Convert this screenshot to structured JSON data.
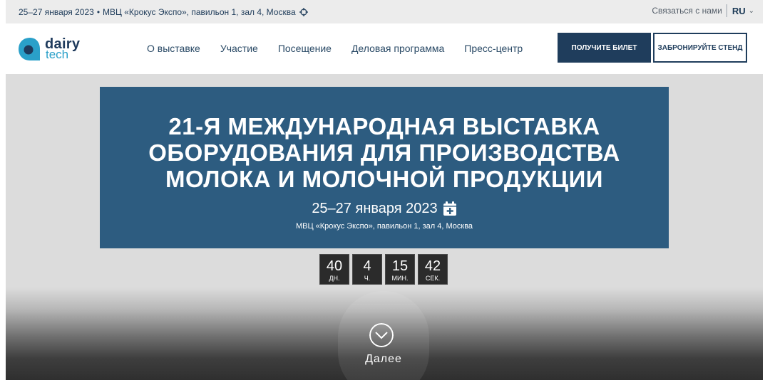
{
  "topbar": {
    "dates": "25–27 января 2023",
    "separator": "•",
    "venue": "МВЦ «Крокус Экспо», павильон 1, зал 4, Москва",
    "contact_label": "Связаться с нами",
    "language": "RU"
  },
  "header": {
    "logo_line1": "dairy",
    "logo_line2": "tech",
    "nav": [
      {
        "label": "О выставке"
      },
      {
        "label": "Участие"
      },
      {
        "label": "Посещение"
      },
      {
        "label": "Деловая программа"
      },
      {
        "label": "Пресс-центр"
      }
    ],
    "ticket_button": "ПОЛУЧИТЕ БИЛЕТ",
    "stand_button": "ЗАБРОНИРУЙТЕ СТЕНД"
  },
  "hero": {
    "title_line1": "21-Я МЕЖДУНАРОДНАЯ ВЫСТАВКА",
    "title_line2": "ОБОРУДОВАНИЯ ДЛЯ ПРОИЗВОДСТВА",
    "title_line3": "МОЛОКА И МОЛОЧНОЙ ПРОДУКЦИИ",
    "date": "25–27 января 2023",
    "venue": "МВЦ «Крокус Экспо», павильон 1, зал 4, Москва",
    "countdown": [
      {
        "value": "40",
        "unit": "ДН."
      },
      {
        "value": "4",
        "unit": "Ч."
      },
      {
        "value": "15",
        "unit": "МИН."
      },
      {
        "value": "42",
        "unit": "СЕК."
      }
    ],
    "scroll_label": "Далее"
  },
  "colors": {
    "brand_dark": "#1f3d5c",
    "banner": "#2d5c80",
    "logo_accent": "#2aa0c9"
  },
  "icons": [
    "target-icon",
    "chevron-down-icon",
    "calendar-add-icon",
    "arrow-down-circle-icon"
  ]
}
